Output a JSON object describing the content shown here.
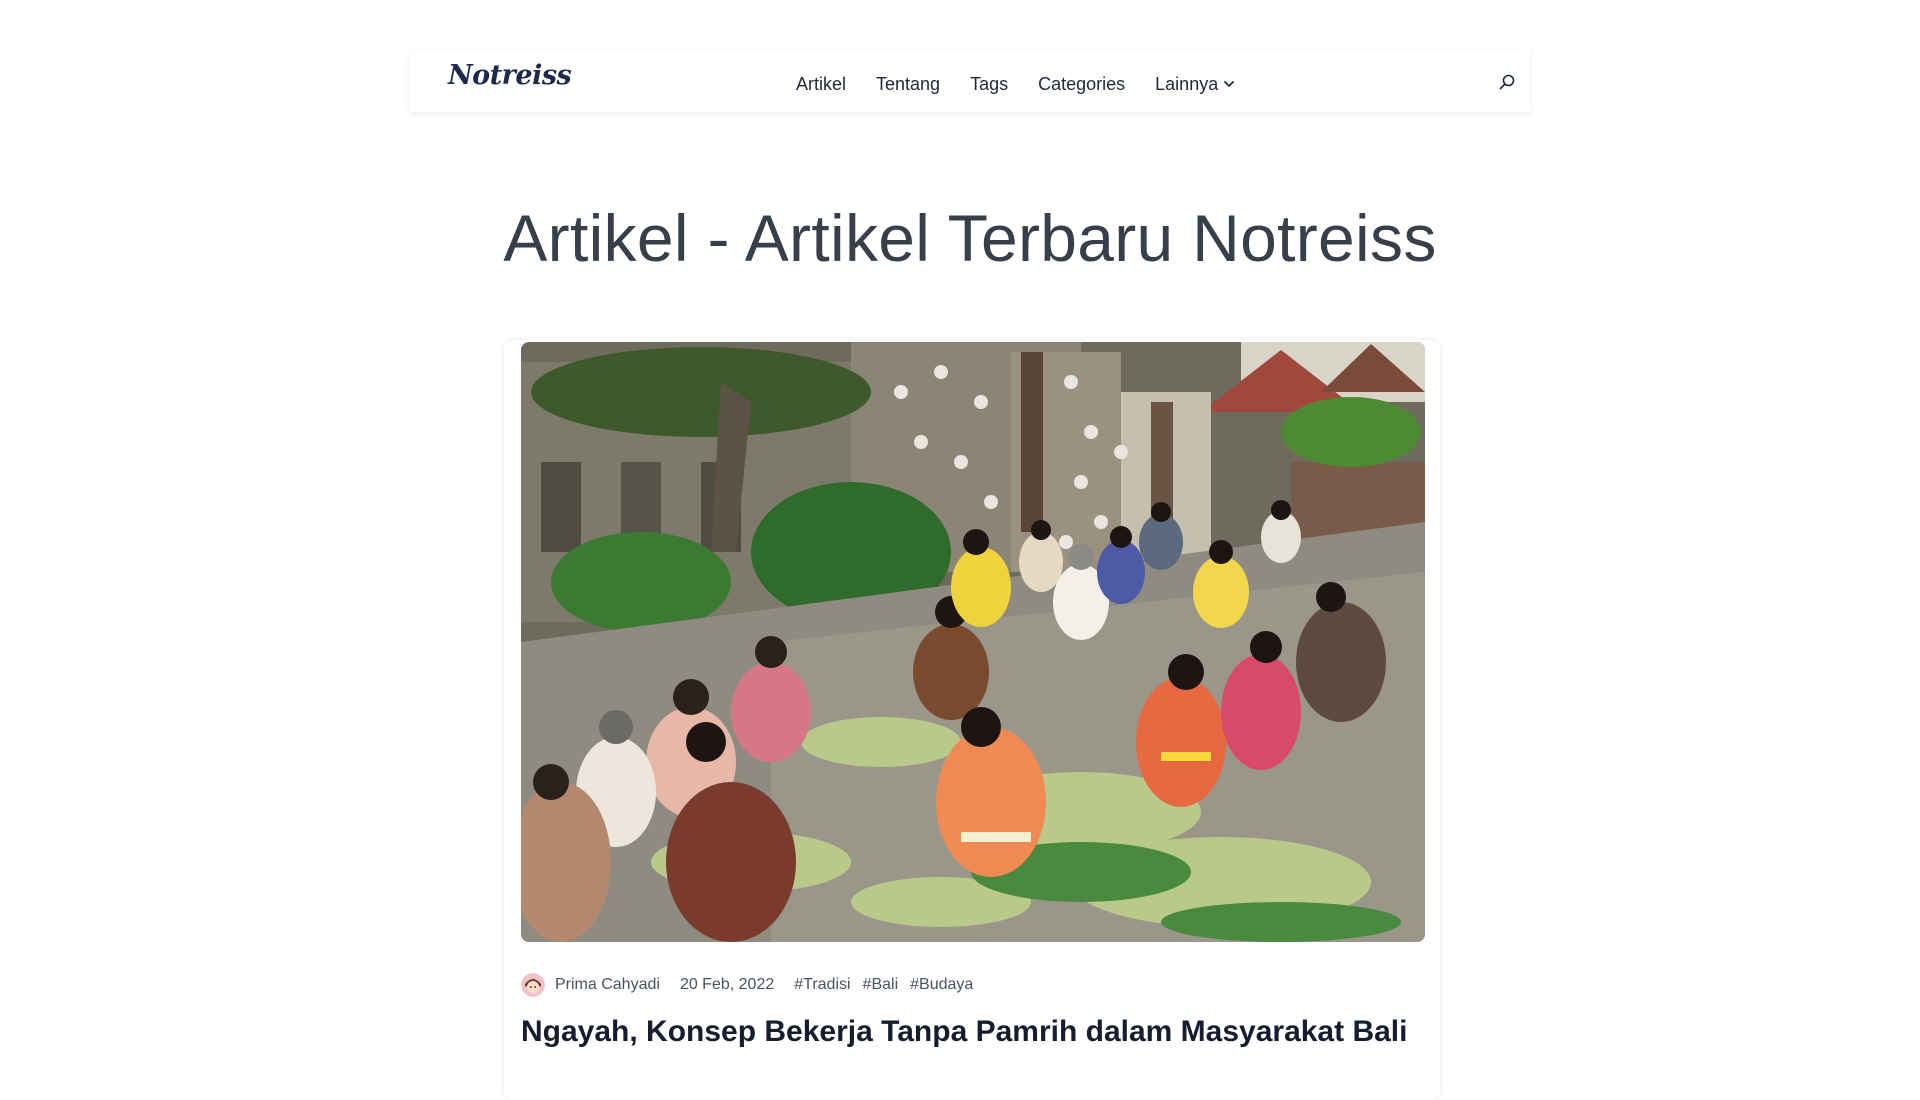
{
  "header": {
    "logo": "Notreiss",
    "nav": [
      {
        "label": "Artikel"
      },
      {
        "label": "Tentang"
      },
      {
        "label": "Tags"
      },
      {
        "label": "Categories"
      },
      {
        "label": "Lainnya"
      }
    ],
    "icons": {
      "search": "search-icon",
      "dropdown": "chevron-down-icon"
    }
  },
  "page": {
    "title": "Artikel - Artikel Terbaru Notreiss"
  },
  "article": {
    "image_alt": "photo-of-balinese-women-weaving-palm-leaves-in-temple-courtyard",
    "author": "Prima Cahyadi",
    "date": "20 Feb, 2022",
    "tags": [
      "#Tradisi",
      "#Bali",
      "#Budaya"
    ],
    "title": "Ngayah, Konsep Bekerja Tanpa Pamrih dalam Masyarakat Bali"
  },
  "colors": {
    "logo": "#1d2a4d",
    "text": "#1f2a37",
    "title": "#363f4a",
    "article_title": "#151d2e"
  }
}
